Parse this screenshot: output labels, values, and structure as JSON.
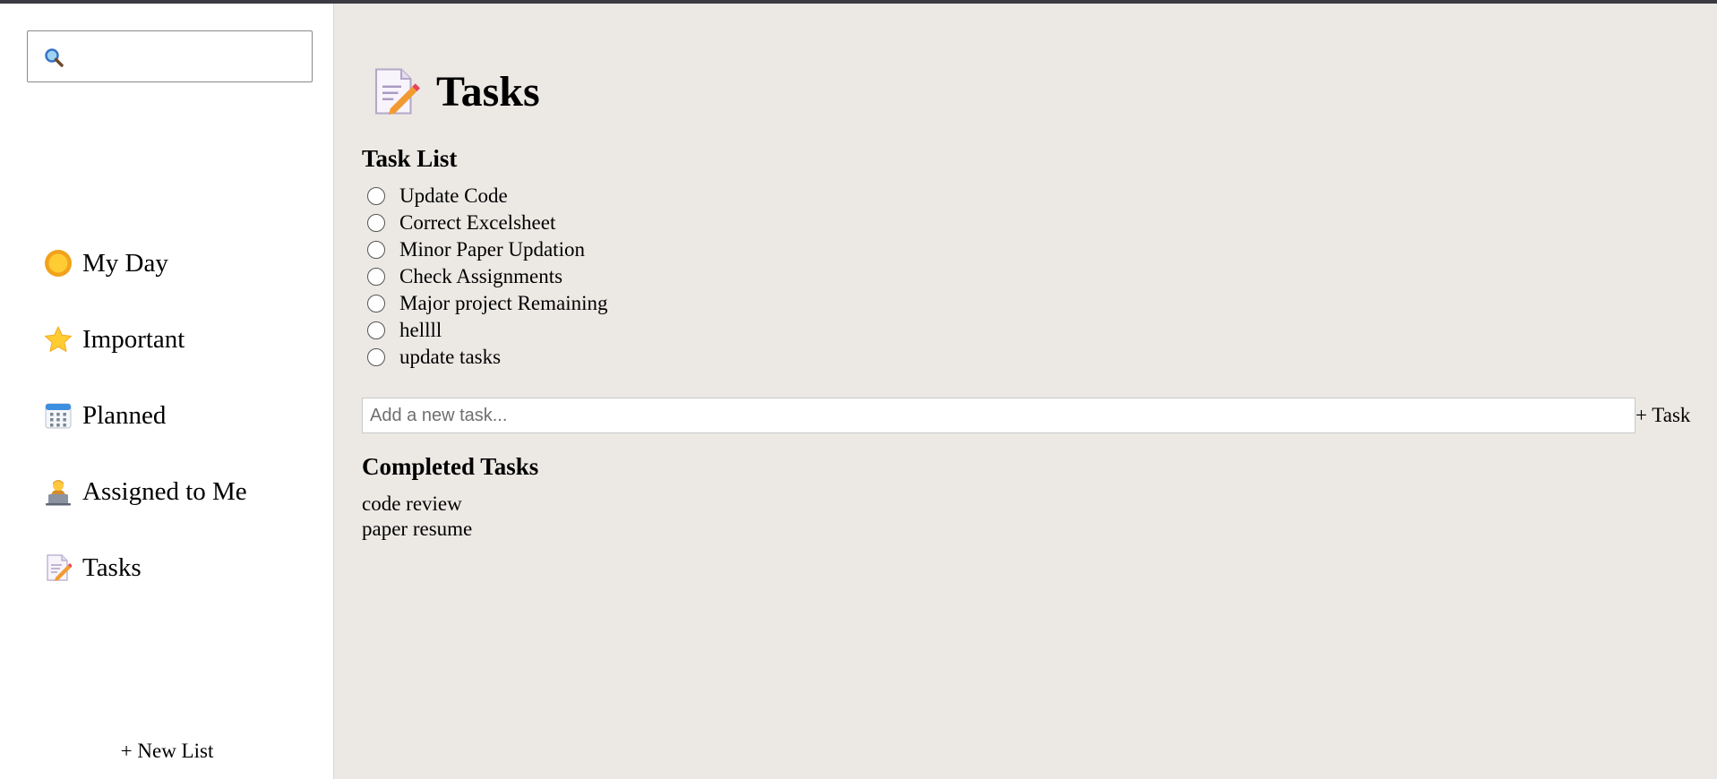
{
  "search": {
    "placeholder": "",
    "value": ""
  },
  "sidebar": {
    "items": [
      {
        "label": "My Day",
        "icon": "sun-icon"
      },
      {
        "label": "Important",
        "icon": "star-icon"
      },
      {
        "label": "Planned",
        "icon": "calendar-icon"
      },
      {
        "label": "Assigned to Me",
        "icon": "person-laptop-icon"
      },
      {
        "label": "Tasks",
        "icon": "memo-icon"
      }
    ],
    "new_list_label": "+ New List"
  },
  "main": {
    "title": "Tasks",
    "title_icon": "memo-icon",
    "task_list_heading": "Task List",
    "tasks": [
      "Update Code",
      "Correct Excelsheet",
      "Minor Paper Updation",
      "Check Assignments",
      "Major project Remaining",
      "hellll",
      "update tasks"
    ],
    "add_task": {
      "placeholder": "Add a new task...",
      "button_label": "+ Task"
    },
    "completed_heading": "Completed Tasks",
    "completed": [
      "code review",
      "paper resume"
    ]
  },
  "colors": {
    "topbar": "#3b3942",
    "main_bg": "#ece9e5",
    "sidebar_bg": "#ffffff"
  }
}
